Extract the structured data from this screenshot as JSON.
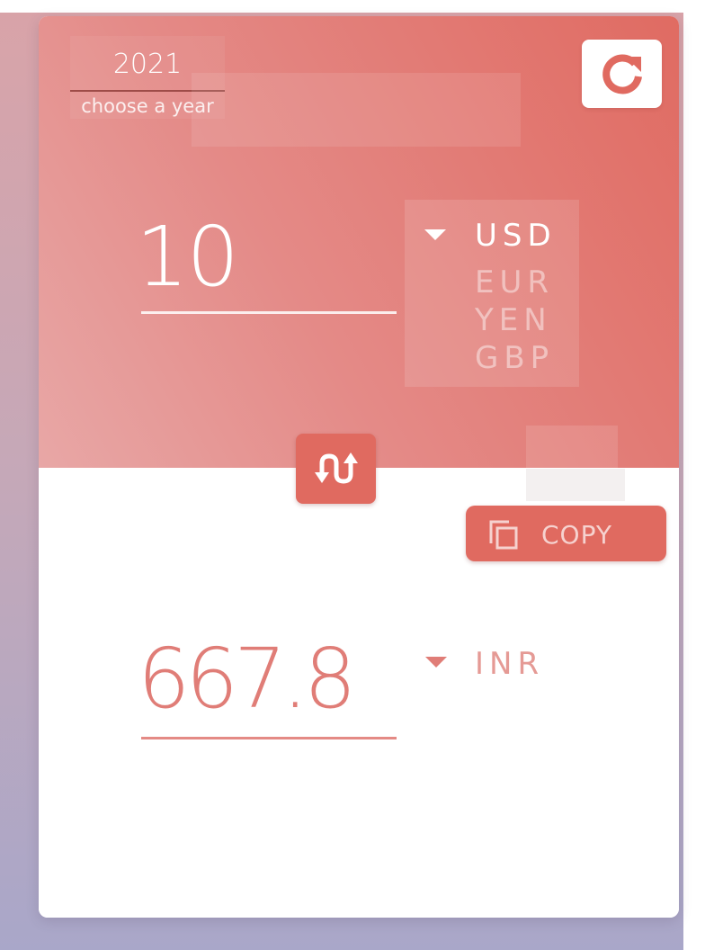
{
  "year": {
    "value": "2021",
    "caption": "choose a year"
  },
  "from": {
    "amount": "10",
    "currencies": [
      "USD",
      "EUR",
      "YEN",
      "GBP"
    ],
    "selected": "USD"
  },
  "to": {
    "amount": "667.8",
    "currency": "INR"
  },
  "buttons": {
    "refresh_icon": "refresh-icon",
    "swap_icon": "swap-arrows-icon",
    "copy_label": "COPY",
    "copy_icon": "copy-icon"
  },
  "colors": {
    "accent": "#e06a60",
    "result_text": "#e07d77"
  }
}
